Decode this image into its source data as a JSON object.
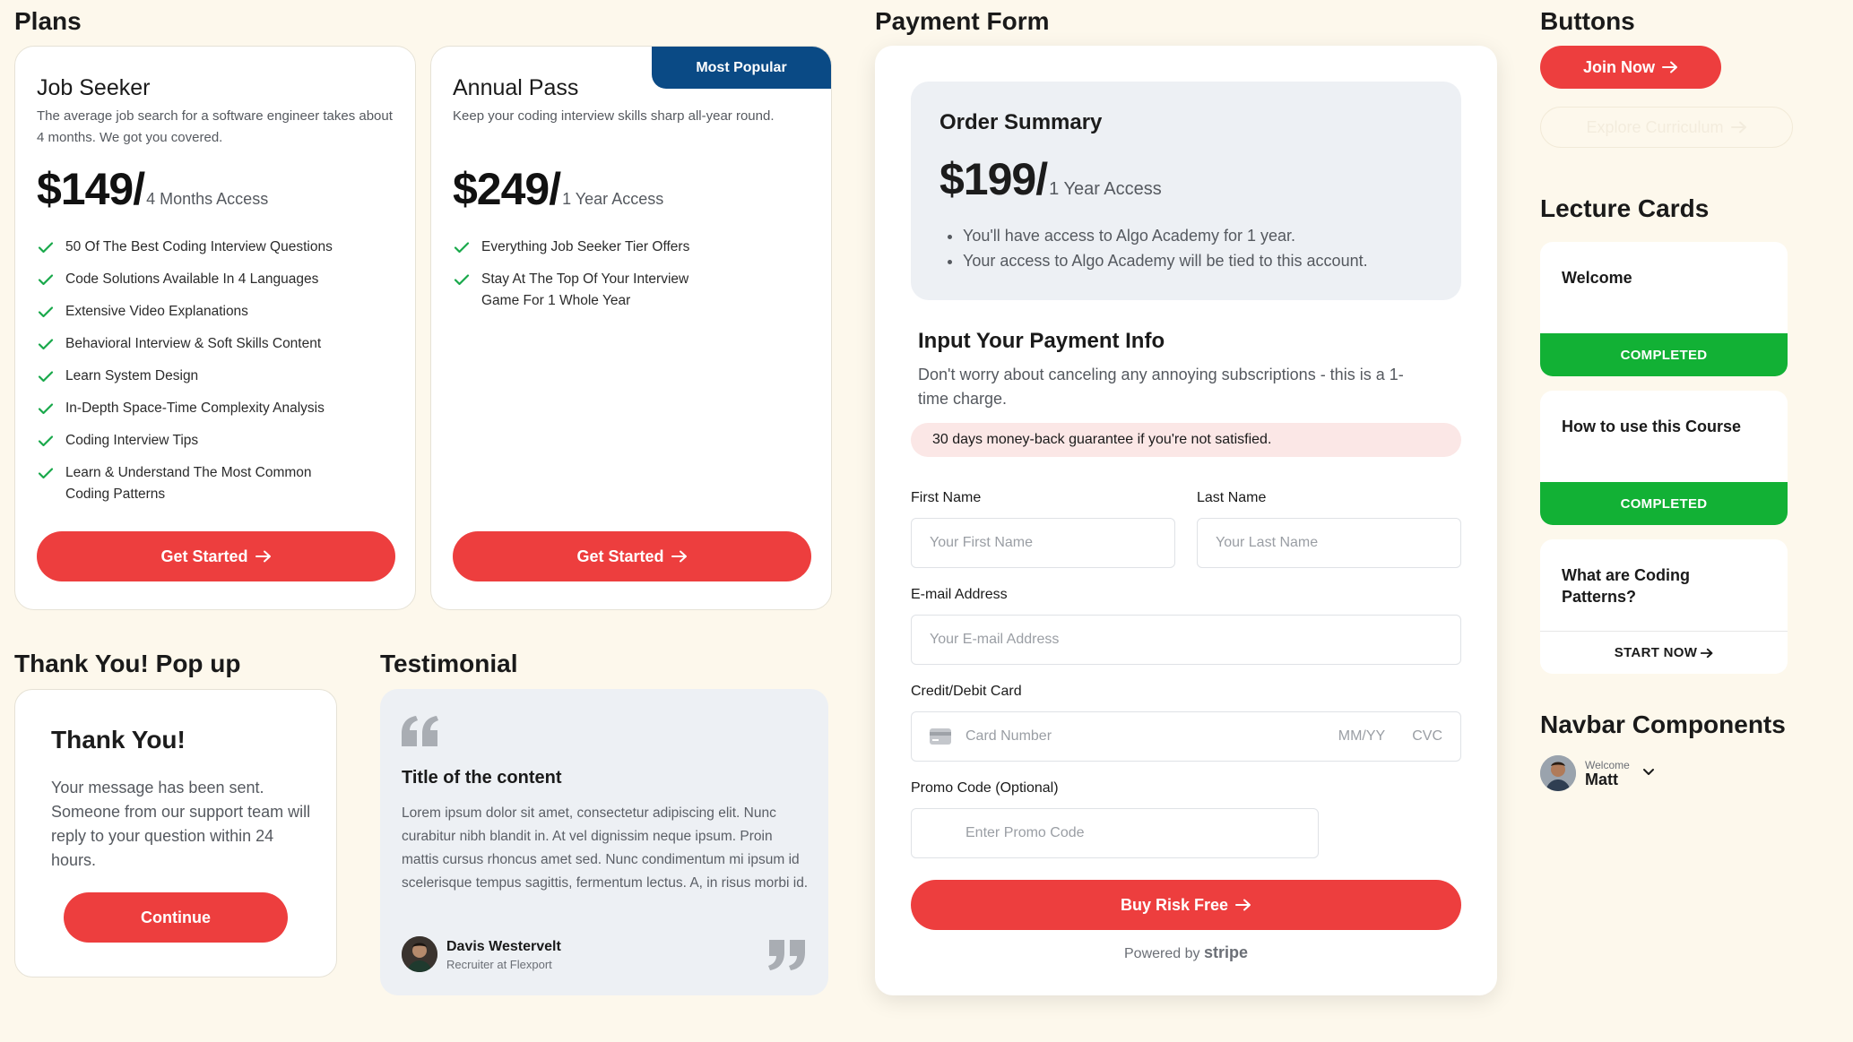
{
  "sections": {
    "plans": "Plans",
    "payment_form": "Payment Form",
    "buttons": "Buttons",
    "lecture_cards": "Lecture Cards",
    "thank_you_popup": "Thank You! Pop up",
    "testimonial": "Testimonial",
    "navbar_components": "Navbar Components"
  },
  "plans": [
    {
      "name": "Job Seeker",
      "description": "The average job search for a software engineer takes about 4 months. We got you covered.",
      "price": "$149/",
      "period": "4 Months Access",
      "features": [
        "50 Of The Best Coding Interview Questions",
        "Code Solutions Available In 4 Languages",
        "Extensive Video Explanations",
        "Behavioral Interview & Soft Skills Content",
        "Learn System Design",
        "In-Depth Space-Time Complexity Analysis",
        "Coding Interview Tips",
        "Learn & Understand The Most Common Coding Patterns"
      ],
      "cta": "Get Started"
    },
    {
      "name": "Annual Pass",
      "badge": "Most Popular",
      "description": "Keep your coding interview skills sharp all-year round.",
      "price": "$249/",
      "period": "1 Year Access",
      "features": [
        "Everything Job Seeker Tier Offers",
        "Stay At The Top Of Your Interview Game For 1 Whole Year"
      ],
      "cta": "Get Started"
    }
  ],
  "thank_you": {
    "title": "Thank You!",
    "message": "Your message has been sent. Someone from our support team will reply to your question within 24 hours.",
    "button": "Continue"
  },
  "testimonial": {
    "title": "Title of the content",
    "body": "Lorem ipsum dolor sit amet, consectetur adipiscing elit. Nunc curabitur nibh blandit in. At vel dignissim neque ipsum. Proin mattis cursus rhoncus amet sed. Nunc condimentum mi ipsum id scelerisque tempus sagittis, fermentum lectus. A, in risus morbi id.",
    "author": "Davis Westervelt",
    "role": "Recruiter at Flexport"
  },
  "payment": {
    "order_summary": {
      "title": "Order Summary",
      "price": "$199/",
      "period": "1 Year Access",
      "bullets": [
        "You'll have access to Algo Academy for 1 year.",
        "Your access to Algo Academy will be tied to this account."
      ]
    },
    "info_title": "Input Your Payment Info",
    "info_sub": "Don't worry about canceling any annoying subscriptions - this is a 1-time charge.",
    "guarantee": "30 days money-back guarantee if you're not satisfied.",
    "first_name": {
      "label": "First Name",
      "placeholder": "Your First Name"
    },
    "last_name": {
      "label": "Last Name",
      "placeholder": "Your Last Name"
    },
    "email": {
      "label": "E-mail Address",
      "placeholder": "Your E-mail Address"
    },
    "card": {
      "label": "Credit/Debit Card",
      "placeholder": "Card Number",
      "expiry": "MM/YY",
      "cvc": "CVC"
    },
    "promo": {
      "label": "Promo Code (Optional)",
      "placeholder": "Enter Promo Code"
    },
    "submit": "Buy Risk Free",
    "powered_by": "Powered by",
    "powered_brand": "stripe"
  },
  "buttons": {
    "primary": "Join Now",
    "ghost": "Explore Curriculum"
  },
  "lecture_cards": [
    {
      "title": "Welcome",
      "status": "COMPLETED"
    },
    {
      "title": "How to use this Course",
      "status": "COMPLETED"
    },
    {
      "title": "What are Coding Patterns?",
      "status": "START NOW"
    }
  ],
  "navbar": {
    "welcome": "Welcome",
    "name": "Matt"
  },
  "colors": {
    "background": "#fdf8ec",
    "accent_red": "#ed3e3e",
    "badge_blue": "#0a4a85",
    "success_green": "#12b135",
    "check_green": "#18a84a",
    "panel_gray": "#edf0f4"
  }
}
